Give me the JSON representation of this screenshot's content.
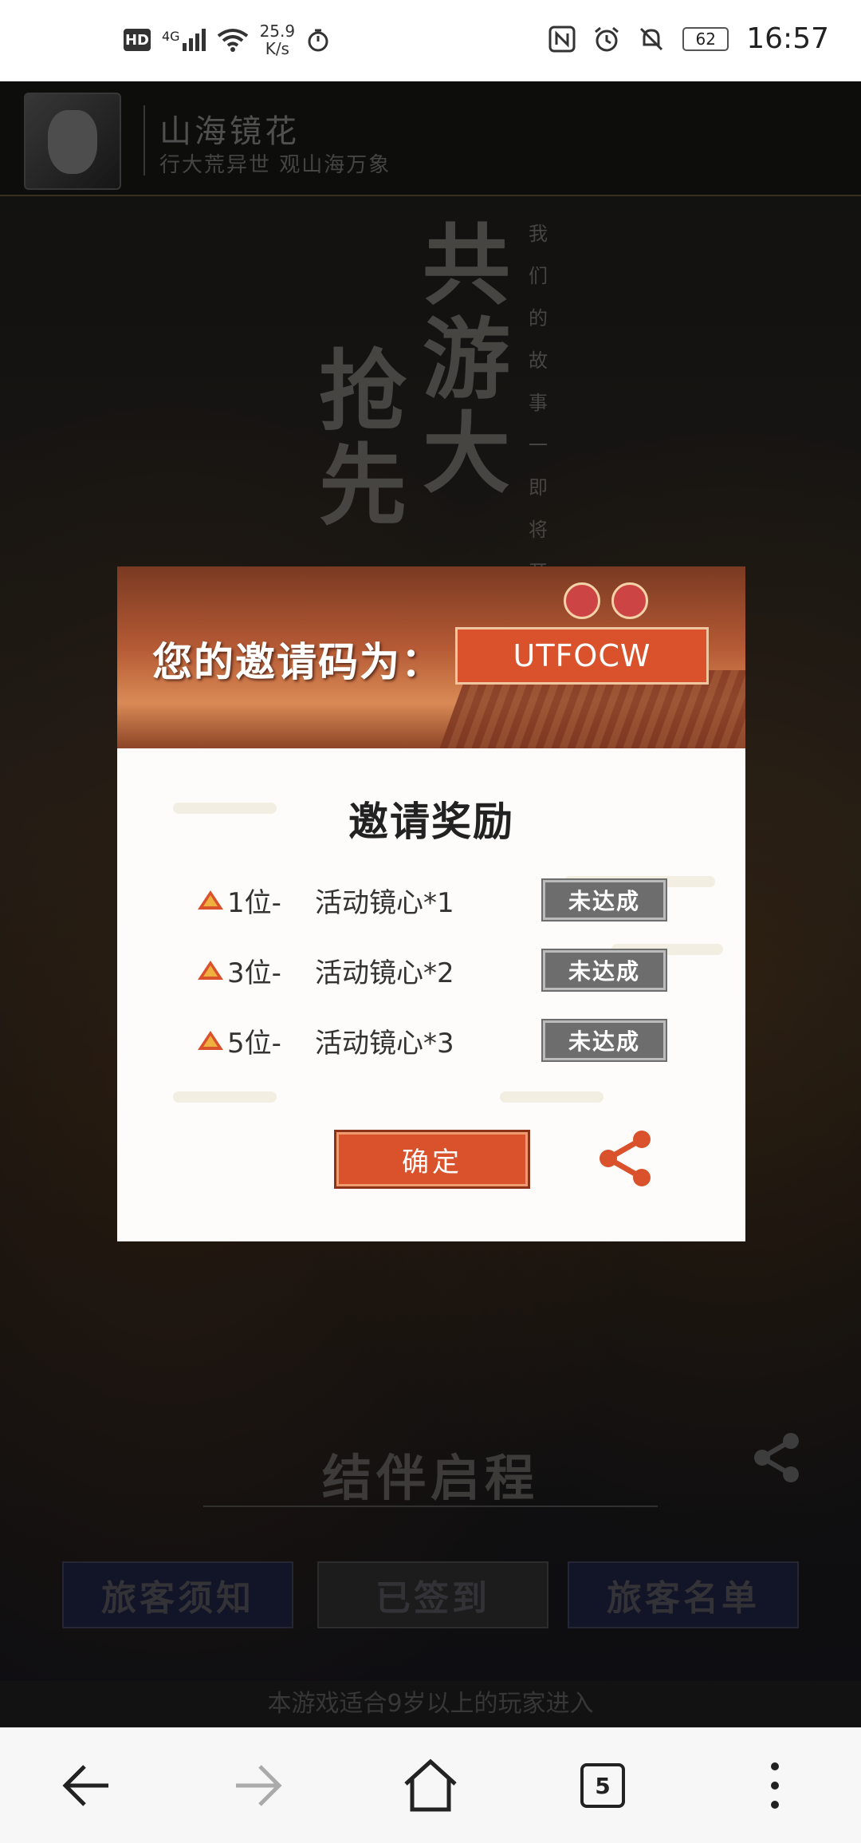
{
  "status_bar": {
    "hd": "HD",
    "signal": "4G",
    "speed_value": "25.9",
    "speed_unit": "K/s",
    "battery": "62",
    "time": "16:57"
  },
  "header": {
    "title": "山海镜花",
    "subtitle": "行大荒异世 观山海万象"
  },
  "background": {
    "big_col1": [
      "抢",
      "先"
    ],
    "big_col2": [
      "共",
      "游",
      "大"
    ],
    "vertical_text": [
      "我",
      "们",
      "的",
      "故",
      "事",
      "一",
      "即",
      "将",
      "开"
    ]
  },
  "dialog": {
    "invite_label": "您的邀请码为：",
    "invite_code": "UTFOCW",
    "reward_title": "邀请奖励",
    "rewards": [
      {
        "rank": "1位-",
        "item": "活动镜心*1",
        "status": "未达成"
      },
      {
        "rank": "3位-",
        "item": "活动镜心*2",
        "status": "未达成"
      },
      {
        "rank": "5位-",
        "item": "活动镜心*3",
        "status": "未达成"
      }
    ],
    "confirm": "确定"
  },
  "bottom": {
    "title": "结伴启程",
    "buttons": [
      "旅客须知",
      "已签到",
      "旅客名单"
    ],
    "age_notice": "本游戏适合9岁以上的玩家进入"
  },
  "navbar": {
    "tabs_count": "5"
  },
  "colors": {
    "accent": "#d9522c",
    "status_gray": "#6d6d6d"
  }
}
